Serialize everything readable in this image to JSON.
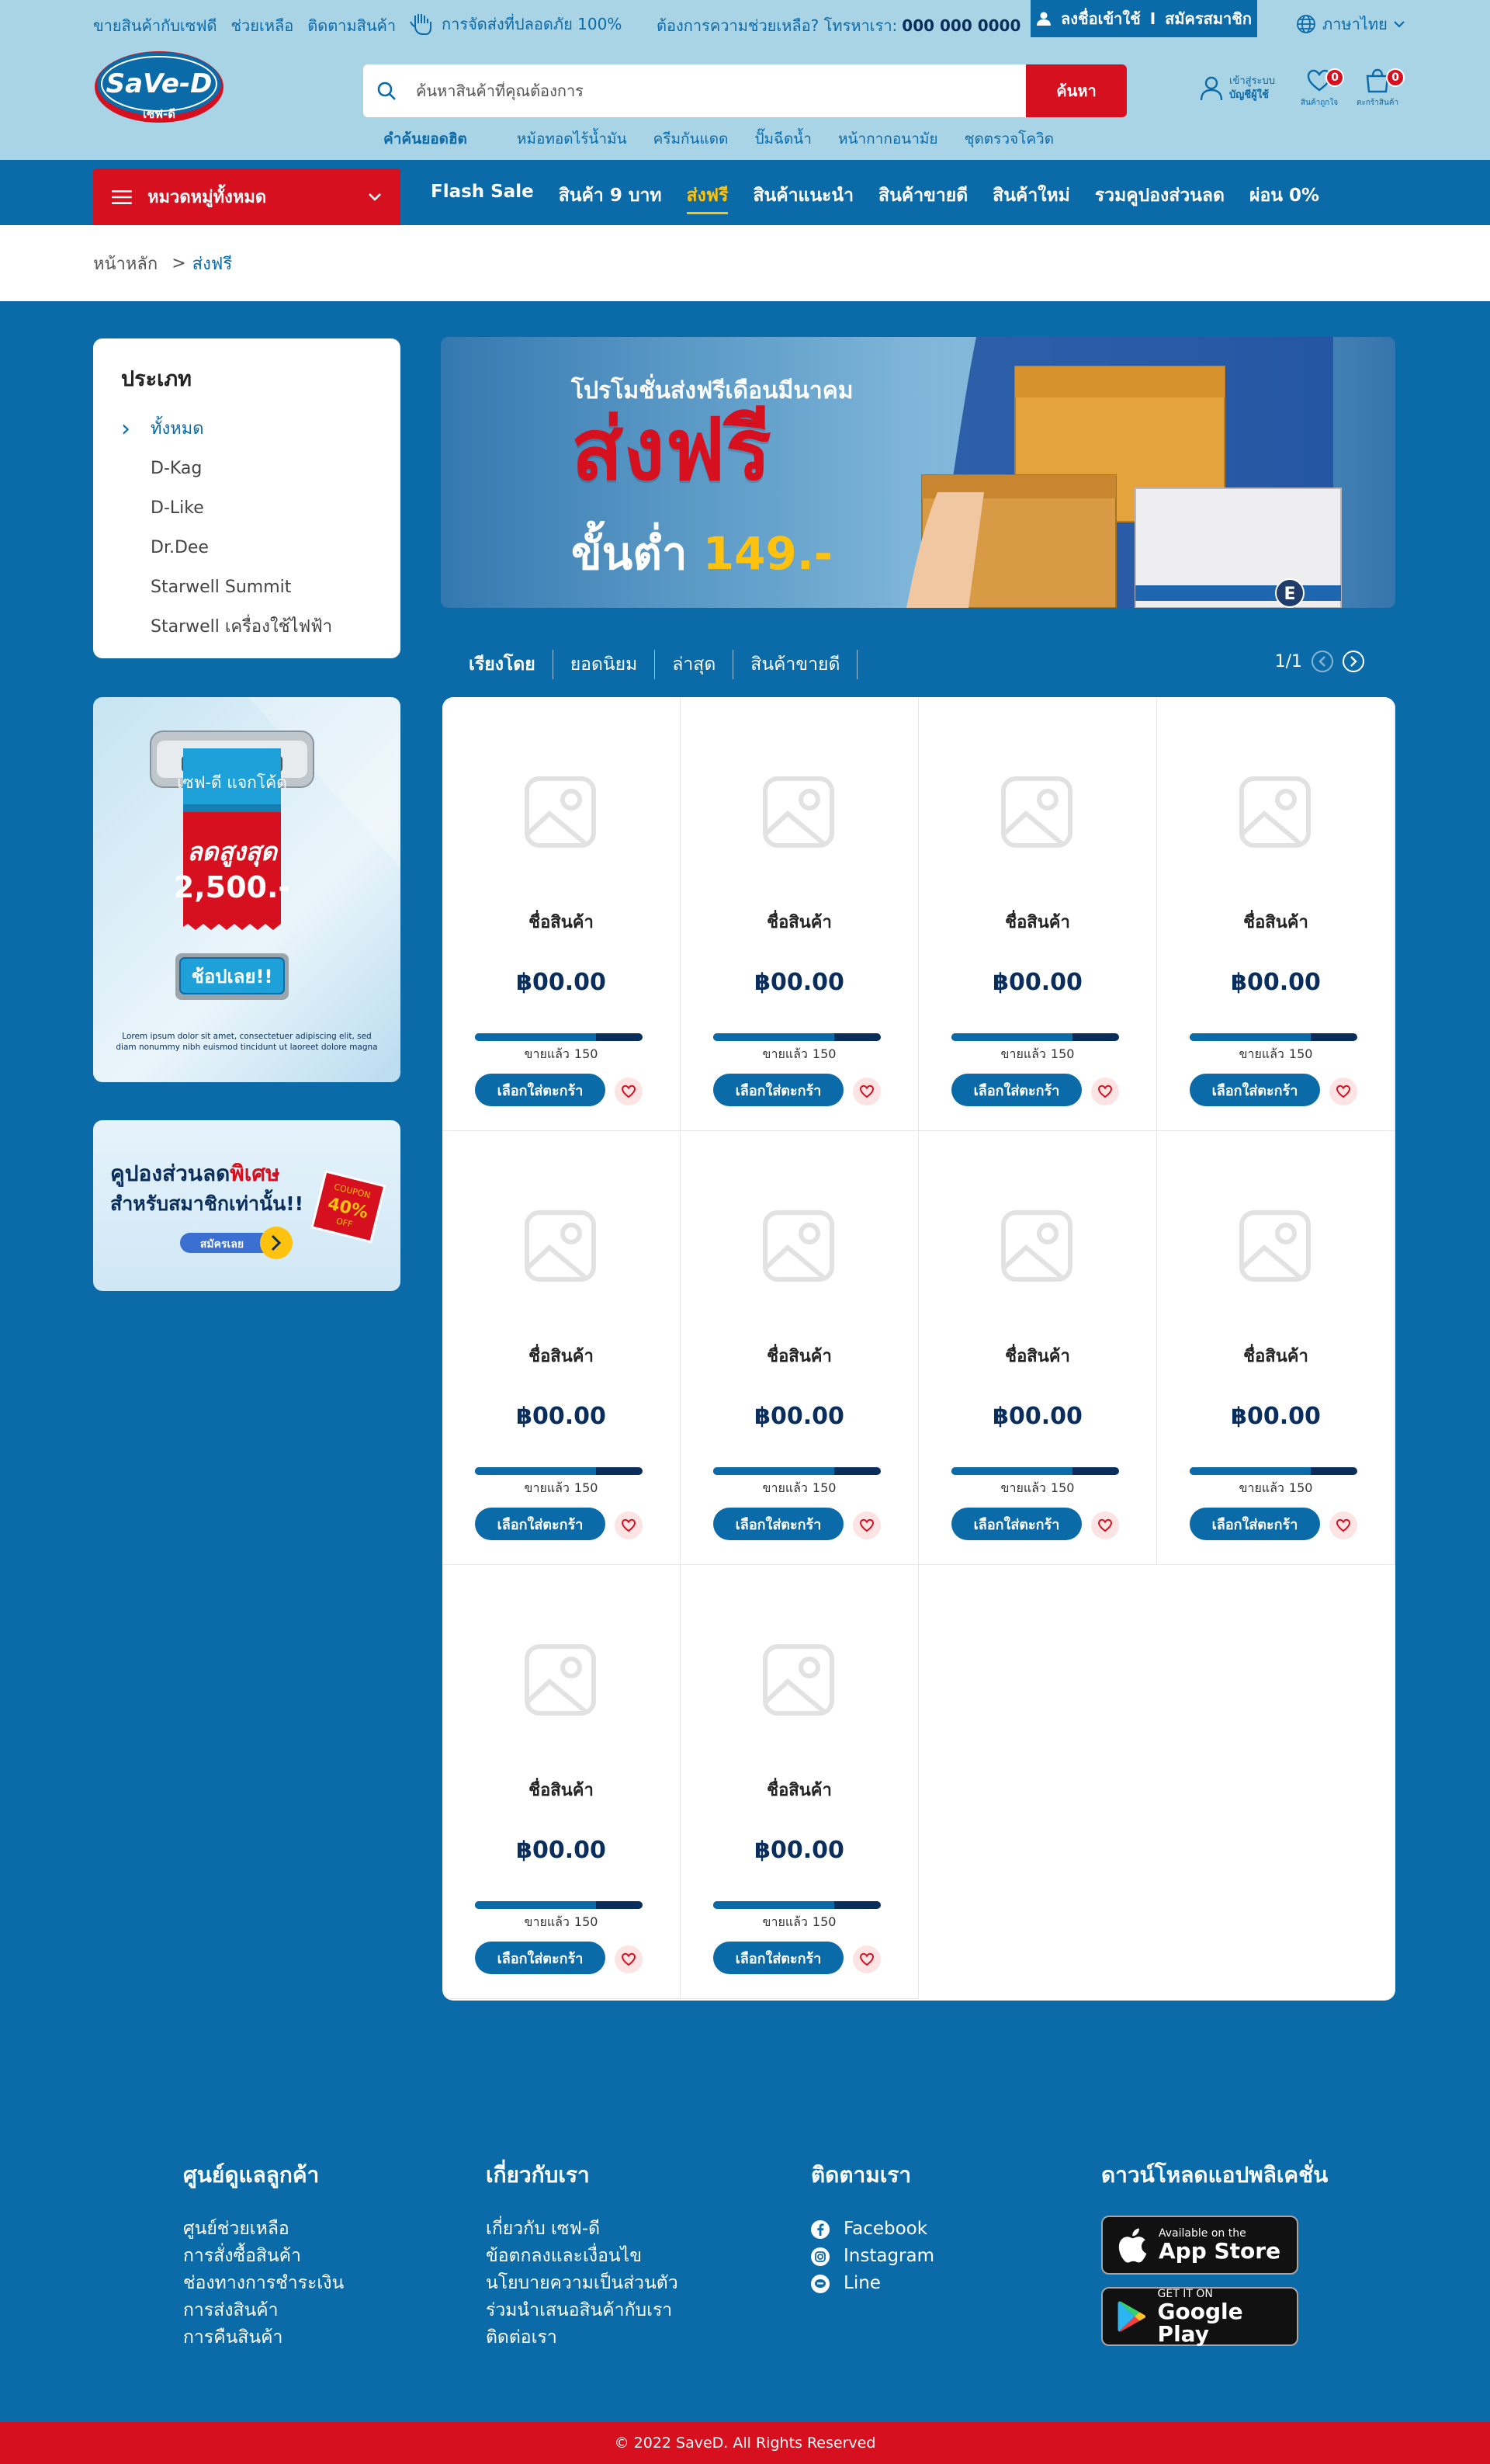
{
  "topbar": {
    "links": [
      "ขายสินค้ากับเซฟดี",
      "ช่วยเหลือ",
      "ติดตามสินค้า"
    ],
    "shipping_note": "การจัดส่งที่ปลอดภัย 100%",
    "help_text": "ต้องการความช่วยเหลือ? โทรหาเรา:",
    "phone": "000 000 0000",
    "login": "ลงชื่อเข้าใช้",
    "divider": "I",
    "register": "สมัครสมาชิก",
    "language": "ภาษาไทย"
  },
  "logo": {
    "brand": "SaVe-D",
    "sub": "เซฟ-ดี"
  },
  "search": {
    "placeholder": "ค้นหาสินค้าที่คุณต้องการ",
    "button": "ค้นหา"
  },
  "hot_keywords": {
    "label": "คำค้นยอดฮิต",
    "items": [
      "หม้อทอดไร้น้ำมัน",
      "ครีมกันแดด",
      "ปั๊มฉีดน้ำ",
      "หน้ากากอนามัย",
      "ชุดตรวจโควิด"
    ]
  },
  "account": {
    "line1": "เข้าสู่ระบบ",
    "line2": "บัญชีผู้ใช้"
  },
  "wishlist": {
    "count": "0",
    "label": "สินค้าถูกใจ"
  },
  "cart": {
    "count": "0",
    "label": "ตะกร้าสินค้า"
  },
  "nav": {
    "categories": "หมวดหมู่ทั้งหมด",
    "items": [
      "Flash Sale",
      "สินค้า 9 บาท",
      "ส่งฟรี",
      "สินค้าแนะนำ",
      "สินค้าขายดี",
      "สินค้าใหม่",
      "รวมคูปองส่วนลด",
      "ผ่อน 0%"
    ],
    "active": "ส่งฟรี"
  },
  "breadcrumb": {
    "home": "หน้าหลัก",
    "sep": ">",
    "current": "ส่งฟรี"
  },
  "sidebar": {
    "title": "ประเภท",
    "items": [
      "ทั้งหมด",
      "D-Kag",
      "D-Like",
      "Dr.Dee",
      "Starwell Summit",
      "Starwell เครื่องใช้ไฟฟ้า"
    ],
    "active_index": 0
  },
  "promo_code": {
    "tag": "เซฟ-ดี แจกโค้ด",
    "line1": "ลดสูงสุด",
    "line2": "2,500.-",
    "button": "ช้อปเลย!!",
    "fine_print_1": "Lorem ipsum dolor sit amet, consectetuer adipiscing elit, sed",
    "fine_print_2": "diam nonummy nibh euismod tincidunt ut laoreet dolore magna"
  },
  "promo_coupon": {
    "line1a": "คูปองส่วนลด",
    "line1b": "พิเศษ",
    "line2": "สำหรับสมาชิกเท่านั้น!!",
    "button": "สมัครเลย",
    "coupon_top": "COUPON",
    "coupon_pct": "40%",
    "coupon_off": "OFF"
  },
  "banner": {
    "line1": "โปรโมชั่นส่งฟรีเดือนมีนาคม",
    "line2": "ส่งฟรี",
    "line3a": "ขั้นต่ำ",
    "line3b": "149.-",
    "box_mark": "E"
  },
  "sort": {
    "label": "เรียงโดย",
    "options": [
      "ยอดนิยม",
      "ล่าสุด",
      "สินค้าขายดี"
    ],
    "page": "1/1"
  },
  "product_defaults": {
    "name": "ชื่อสินค้า",
    "price": "฿00.00",
    "sold_label": "ขายแล้ว",
    "sold": "150",
    "sold_ratio": 0.72,
    "add_button": "เลือกใส่ตะกร้า"
  },
  "products": [
    {},
    {},
    {},
    {},
    {},
    {},
    {},
    {},
    {},
    {}
  ],
  "footer": {
    "customer_care": {
      "title": "ศูนย์ดูแลลูกค้า",
      "items": [
        "ศูนย์ช่วยเหลือ",
        "การสั่งซื้อสินค้า",
        "ช่องทางการชำระเงิน",
        "การส่งสินค้า",
        "การคืนสินค้า"
      ]
    },
    "about": {
      "title": "เกี่ยวกับเรา",
      "items": [
        "เกี่ยวกับ เซฟ-ดี",
        "ข้อตกลงและเงื่อนไข",
        "นโยบายความเป็นส่วนตัว",
        "ร่วมนำเสนอสินค้ากับเรา",
        "ติดต่อเรา"
      ]
    },
    "follow": {
      "title": "ติดตามเรา",
      "items": [
        "Facebook",
        "Instagram",
        "Line"
      ]
    },
    "app": {
      "title": "ดาวน์โหลดแอปพลิเคชั่น",
      "appstore_small": "Available on the",
      "appstore_big": "App Store",
      "gplay_small": "GET IT ON",
      "gplay_big": "Google Play"
    }
  },
  "copyright": "© 2022 SaveD. All Rights Reserved",
  "colors": {
    "brand_blue": "#0b6aa8",
    "brand_red": "#d6101e",
    "header_bg": "#a9d4e6",
    "accent_yellow": "#ffc20e",
    "navy": "#0a2e5c"
  }
}
